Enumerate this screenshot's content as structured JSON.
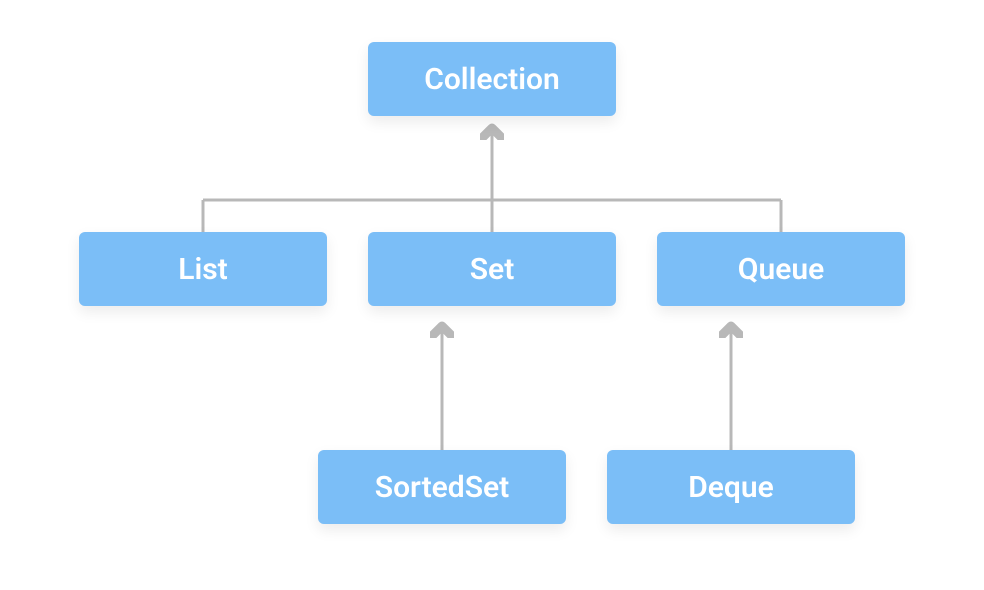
{
  "diagram": {
    "root": {
      "label": "Collection"
    },
    "level1": [
      {
        "label": "List"
      },
      {
        "label": "Set"
      },
      {
        "label": "Queue"
      }
    ],
    "level2": [
      {
        "label": "SortedSet"
      },
      {
        "label": "Deque"
      }
    ]
  }
}
